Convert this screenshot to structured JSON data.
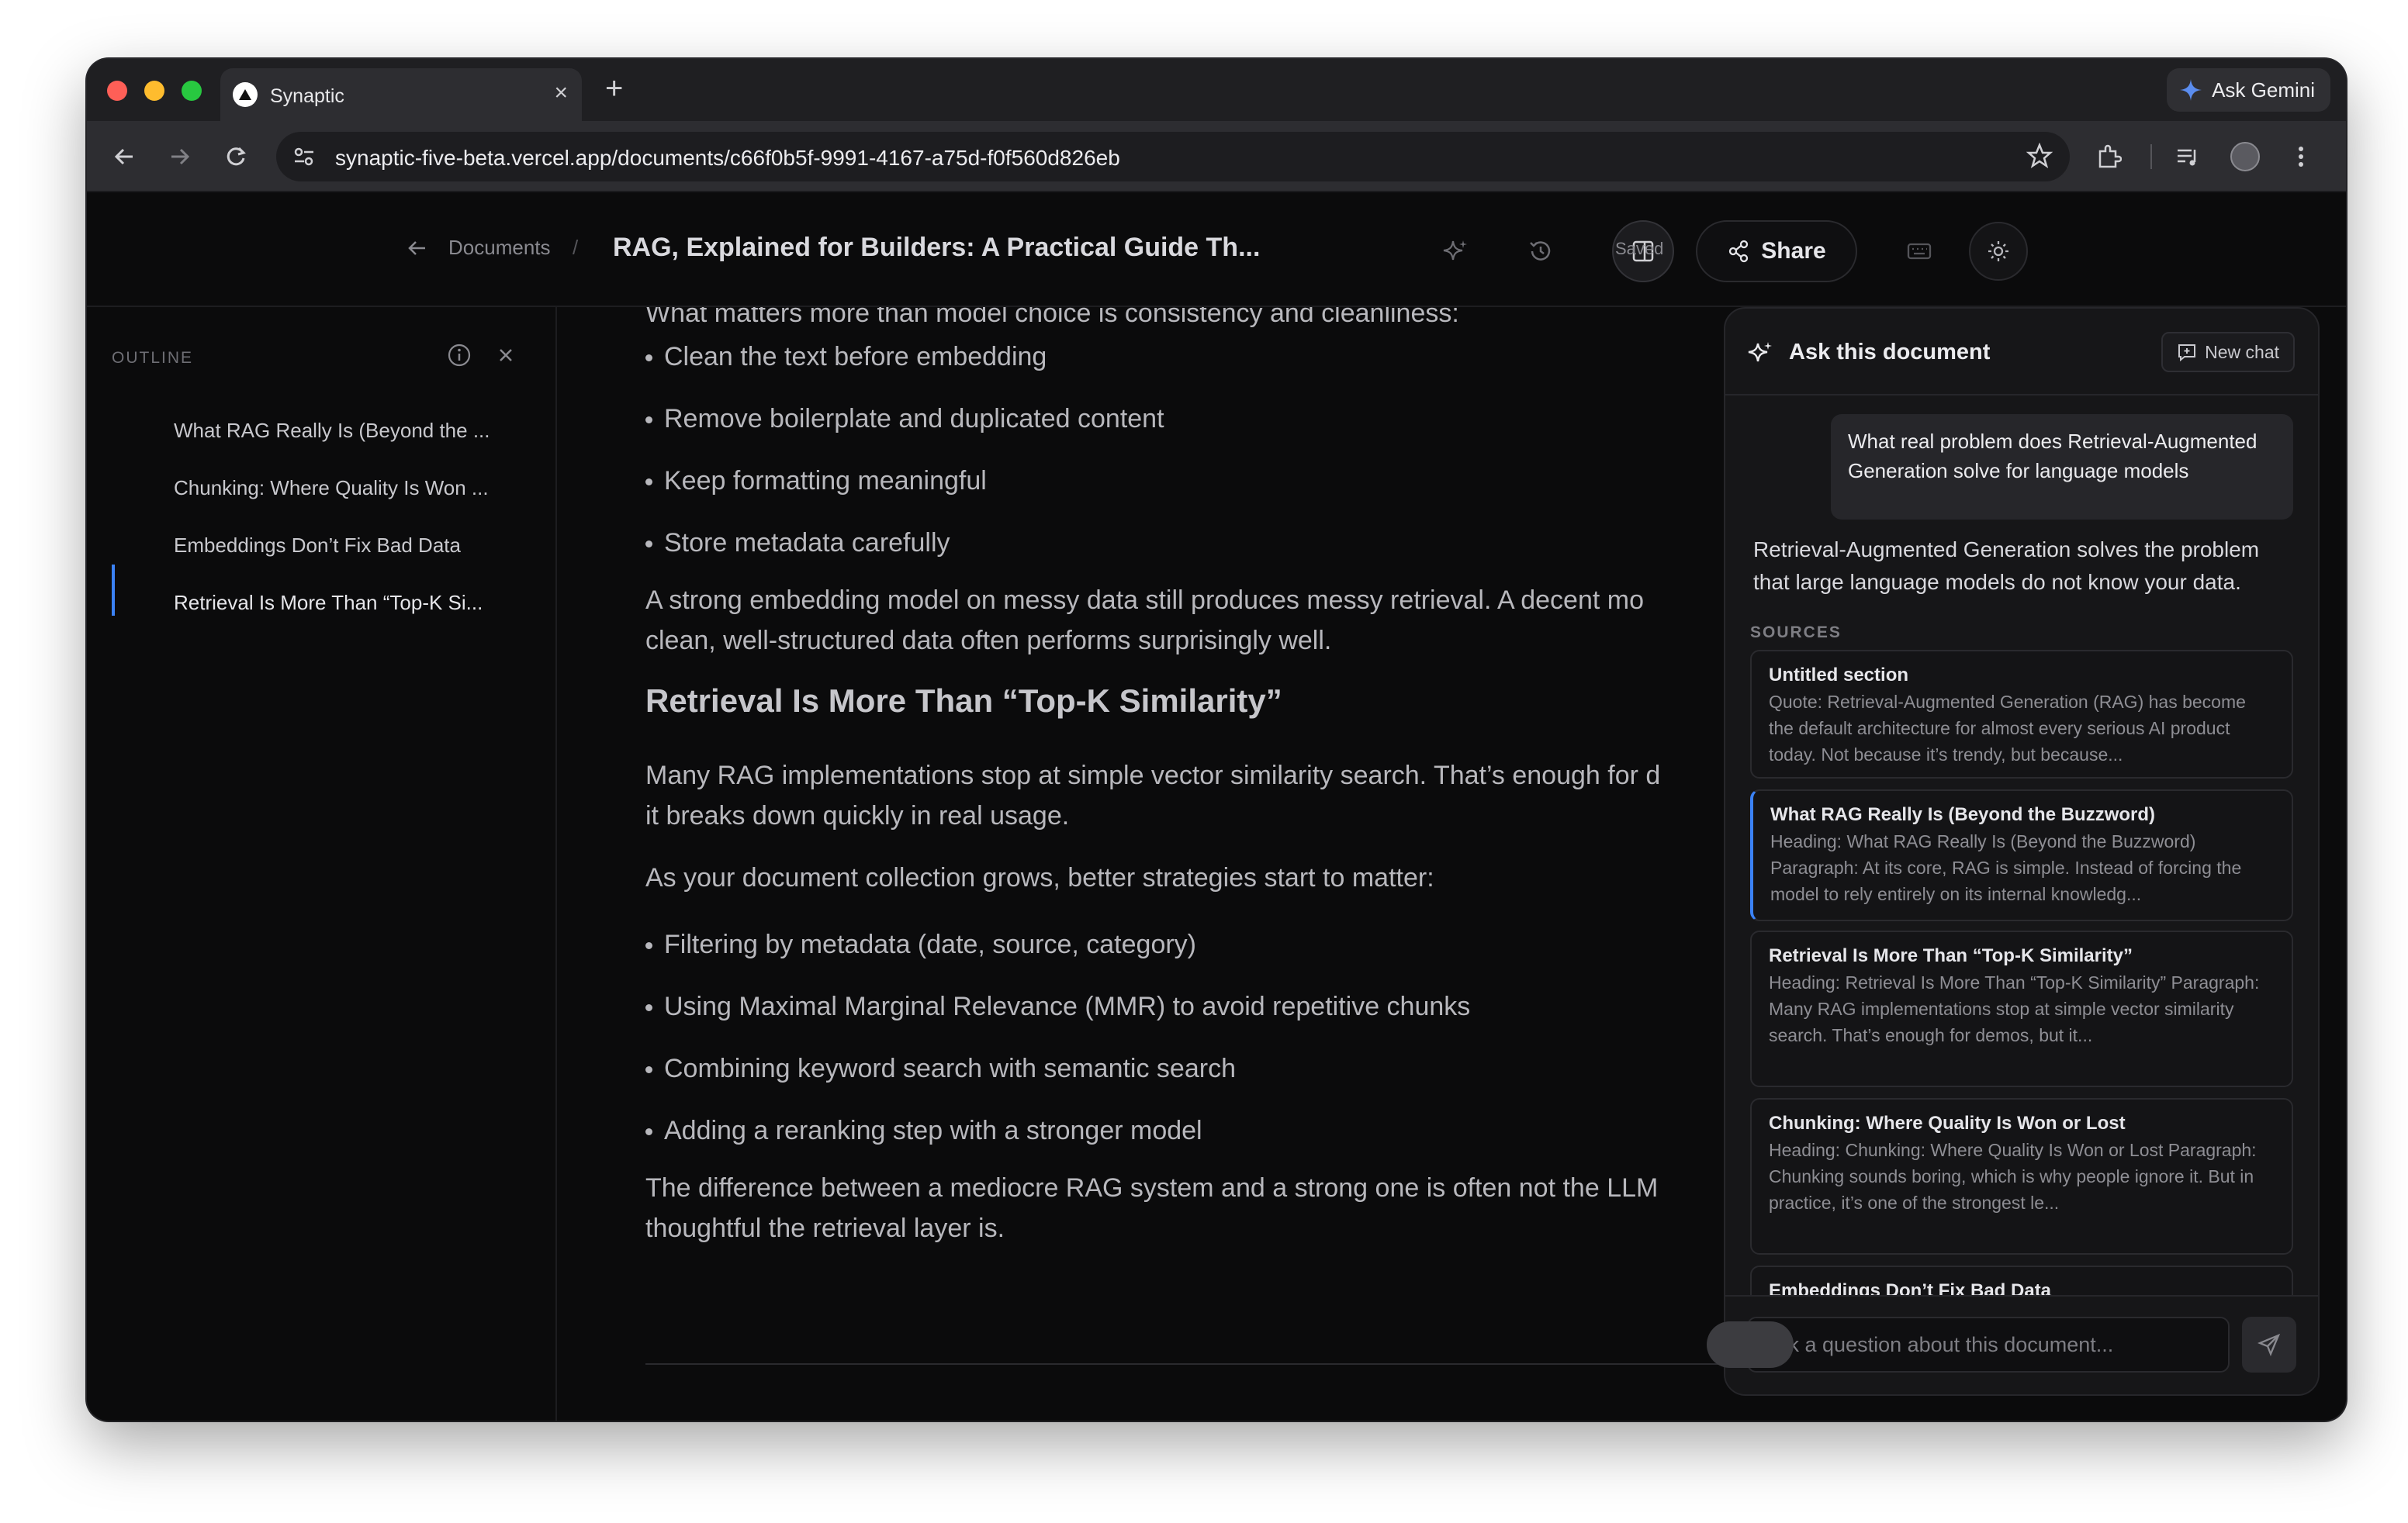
{
  "browser": {
    "tab_title": "Synaptic",
    "tab_close": "×",
    "new_tab": "+",
    "ask_gemini": "Ask Gemini",
    "url": "synaptic-five-beta.vercel.app/documents/c66f0b5f-9991-4167-a75d-f0f560d826eb"
  },
  "header": {
    "breadcrumb_documents": "Documents",
    "breadcrumb_separator": "/",
    "doc_title": "RAG, Explained for Builders: A Practical Guide Th...",
    "saved_label": "Saved",
    "share_label": "Share"
  },
  "outline": {
    "label": "OUTLINE",
    "items": [
      {
        "label": "What RAG Really Is (Beyond the ..."
      },
      {
        "label": "Chunking: Where Quality Is Won ..."
      },
      {
        "label": "Embeddings Don’t Fix Bad Data"
      },
      {
        "label": "Retrieval Is More Than “Top-K Si..."
      }
    ]
  },
  "document": {
    "p_top": "What matters more than model choice is consistency and cleanliness:",
    "bullets_1": [
      "Clean the text before embedding",
      "Remove boilerplate and duplicated content",
      "Keep formatting meaningful",
      "Store metadata carefully"
    ],
    "p_embed_1": "A strong embedding model on messy data still produces messy retrieval. A decent mo",
    "p_embed_2": "clean, well-structured data often performs surprisingly well.",
    "h_retrieval": "Retrieval Is More Than “Top-K Similarity”",
    "p_rag_1": "Many RAG implementations stop at simple vector similarity search. That’s enough for d",
    "p_rag_2": "it breaks down quickly in real usage.",
    "p_grows": "As your document collection grows, better strategies start to matter:",
    "bullets_2": [
      "Filtering by metadata (date, source, category)",
      "Using Maximal Marginal Relevance (MMR) to avoid repetitive chunks",
      "Combining keyword search with semantic search",
      "Adding a reranking step with a stronger model"
    ],
    "p_diff_1": "The difference between a mediocre RAG system and a strong one is often not the LLM",
    "p_diff_2": "thoughtful the retrieval layer is."
  },
  "ask_panel": {
    "title": "Ask this document",
    "new_chat": "New chat",
    "user_question": "What real problem does Retrieval-Augmented Generation solve for language models",
    "answer": "Retrieval-Augmented Generation solves the problem that large language models do not know your data.",
    "sources_label": "SOURCES",
    "sources": [
      {
        "title": "Untitled section",
        "body": "Quote: Retrieval-Augmented Generation (RAG) has become the default architecture for almost every serious AI product today. Not because it’s trendy, but because..."
      },
      {
        "title": "What RAG Really Is (Beyond the Buzzword)",
        "body": "Heading: What RAG Really Is (Beyond the Buzzword) Paragraph: At its core, RAG is simple. Instead of forcing the model to rely entirely on its internal knowledg..."
      },
      {
        "title": "Retrieval Is More Than “Top-K Similarity”",
        "body": "Heading: Retrieval Is More Than “Top-K Similarity” Paragraph: Many RAG implementations stop at simple vector similarity search. That’s enough for demos, but it..."
      },
      {
        "title": "Chunking: Where Quality Is Won or Lost",
        "body": "Heading: Chunking: Where Quality Is Won or Lost Paragraph: Chunking sounds boring, which is why people ignore it. But in practice, it’s one of the strongest le..."
      },
      {
        "title": "Embeddings Don’t Fix Bad Data",
        "body": ""
      }
    ],
    "input_placeholder": "Ask a question about this document..."
  }
}
